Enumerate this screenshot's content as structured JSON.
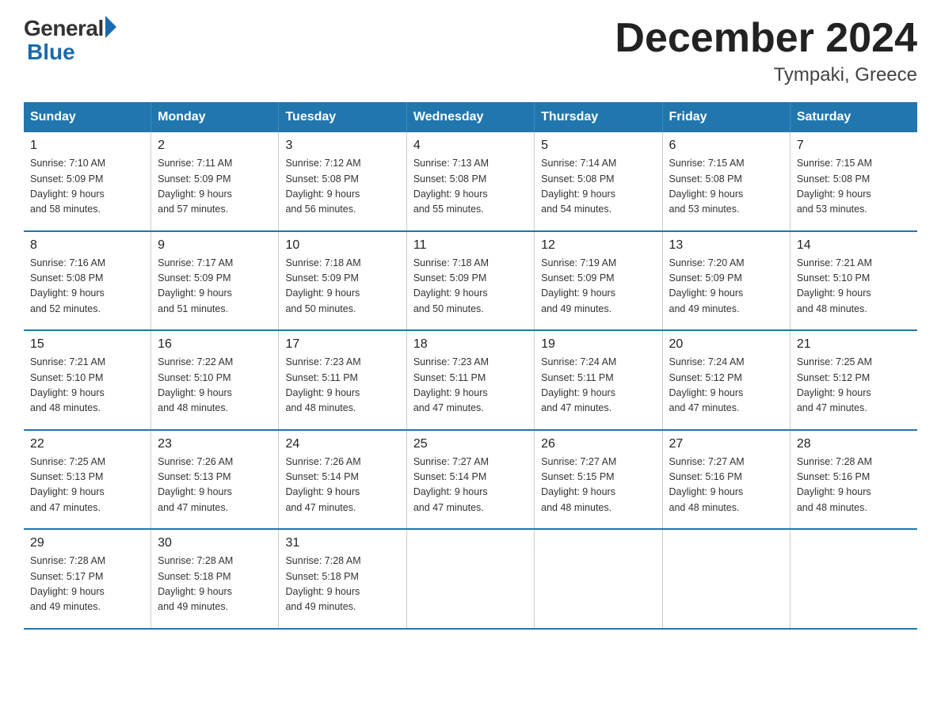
{
  "logo": {
    "general": "General",
    "blue": "Blue"
  },
  "title": {
    "month_year": "December 2024",
    "location": "Tympaki, Greece"
  },
  "header_days": [
    "Sunday",
    "Monday",
    "Tuesday",
    "Wednesday",
    "Thursday",
    "Friday",
    "Saturday"
  ],
  "weeks": [
    [
      {
        "day": "1",
        "sunrise": "7:10 AM",
        "sunset": "5:09 PM",
        "daylight": "9 hours and 58 minutes."
      },
      {
        "day": "2",
        "sunrise": "7:11 AM",
        "sunset": "5:09 PM",
        "daylight": "9 hours and 57 minutes."
      },
      {
        "day": "3",
        "sunrise": "7:12 AM",
        "sunset": "5:08 PM",
        "daylight": "9 hours and 56 minutes."
      },
      {
        "day": "4",
        "sunrise": "7:13 AM",
        "sunset": "5:08 PM",
        "daylight": "9 hours and 55 minutes."
      },
      {
        "day": "5",
        "sunrise": "7:14 AM",
        "sunset": "5:08 PM",
        "daylight": "9 hours and 54 minutes."
      },
      {
        "day": "6",
        "sunrise": "7:15 AM",
        "sunset": "5:08 PM",
        "daylight": "9 hours and 53 minutes."
      },
      {
        "day": "7",
        "sunrise": "7:15 AM",
        "sunset": "5:08 PM",
        "daylight": "9 hours and 53 minutes."
      }
    ],
    [
      {
        "day": "8",
        "sunrise": "7:16 AM",
        "sunset": "5:08 PM",
        "daylight": "9 hours and 52 minutes."
      },
      {
        "day": "9",
        "sunrise": "7:17 AM",
        "sunset": "5:09 PM",
        "daylight": "9 hours and 51 minutes."
      },
      {
        "day": "10",
        "sunrise": "7:18 AM",
        "sunset": "5:09 PM",
        "daylight": "9 hours and 50 minutes."
      },
      {
        "day": "11",
        "sunrise": "7:18 AM",
        "sunset": "5:09 PM",
        "daylight": "9 hours and 50 minutes."
      },
      {
        "day": "12",
        "sunrise": "7:19 AM",
        "sunset": "5:09 PM",
        "daylight": "9 hours and 49 minutes."
      },
      {
        "day": "13",
        "sunrise": "7:20 AM",
        "sunset": "5:09 PM",
        "daylight": "9 hours and 49 minutes."
      },
      {
        "day": "14",
        "sunrise": "7:21 AM",
        "sunset": "5:10 PM",
        "daylight": "9 hours and 48 minutes."
      }
    ],
    [
      {
        "day": "15",
        "sunrise": "7:21 AM",
        "sunset": "5:10 PM",
        "daylight": "9 hours and 48 minutes."
      },
      {
        "day": "16",
        "sunrise": "7:22 AM",
        "sunset": "5:10 PM",
        "daylight": "9 hours and 48 minutes."
      },
      {
        "day": "17",
        "sunrise": "7:23 AM",
        "sunset": "5:11 PM",
        "daylight": "9 hours and 48 minutes."
      },
      {
        "day": "18",
        "sunrise": "7:23 AM",
        "sunset": "5:11 PM",
        "daylight": "9 hours and 47 minutes."
      },
      {
        "day": "19",
        "sunrise": "7:24 AM",
        "sunset": "5:11 PM",
        "daylight": "9 hours and 47 minutes."
      },
      {
        "day": "20",
        "sunrise": "7:24 AM",
        "sunset": "5:12 PM",
        "daylight": "9 hours and 47 minutes."
      },
      {
        "day": "21",
        "sunrise": "7:25 AM",
        "sunset": "5:12 PM",
        "daylight": "9 hours and 47 minutes."
      }
    ],
    [
      {
        "day": "22",
        "sunrise": "7:25 AM",
        "sunset": "5:13 PM",
        "daylight": "9 hours and 47 minutes."
      },
      {
        "day": "23",
        "sunrise": "7:26 AM",
        "sunset": "5:13 PM",
        "daylight": "9 hours and 47 minutes."
      },
      {
        "day": "24",
        "sunrise": "7:26 AM",
        "sunset": "5:14 PM",
        "daylight": "9 hours and 47 minutes."
      },
      {
        "day": "25",
        "sunrise": "7:27 AM",
        "sunset": "5:14 PM",
        "daylight": "9 hours and 47 minutes."
      },
      {
        "day": "26",
        "sunrise": "7:27 AM",
        "sunset": "5:15 PM",
        "daylight": "9 hours and 48 minutes."
      },
      {
        "day": "27",
        "sunrise": "7:27 AM",
        "sunset": "5:16 PM",
        "daylight": "9 hours and 48 minutes."
      },
      {
        "day": "28",
        "sunrise": "7:28 AM",
        "sunset": "5:16 PM",
        "daylight": "9 hours and 48 minutes."
      }
    ],
    [
      {
        "day": "29",
        "sunrise": "7:28 AM",
        "sunset": "5:17 PM",
        "daylight": "9 hours and 49 minutes."
      },
      {
        "day": "30",
        "sunrise": "7:28 AM",
        "sunset": "5:18 PM",
        "daylight": "9 hours and 49 minutes."
      },
      {
        "day": "31",
        "sunrise": "7:28 AM",
        "sunset": "5:18 PM",
        "daylight": "9 hours and 49 minutes."
      },
      null,
      null,
      null,
      null
    ]
  ],
  "labels": {
    "sunrise": "Sunrise:",
    "sunset": "Sunset:",
    "daylight": "Daylight:"
  }
}
